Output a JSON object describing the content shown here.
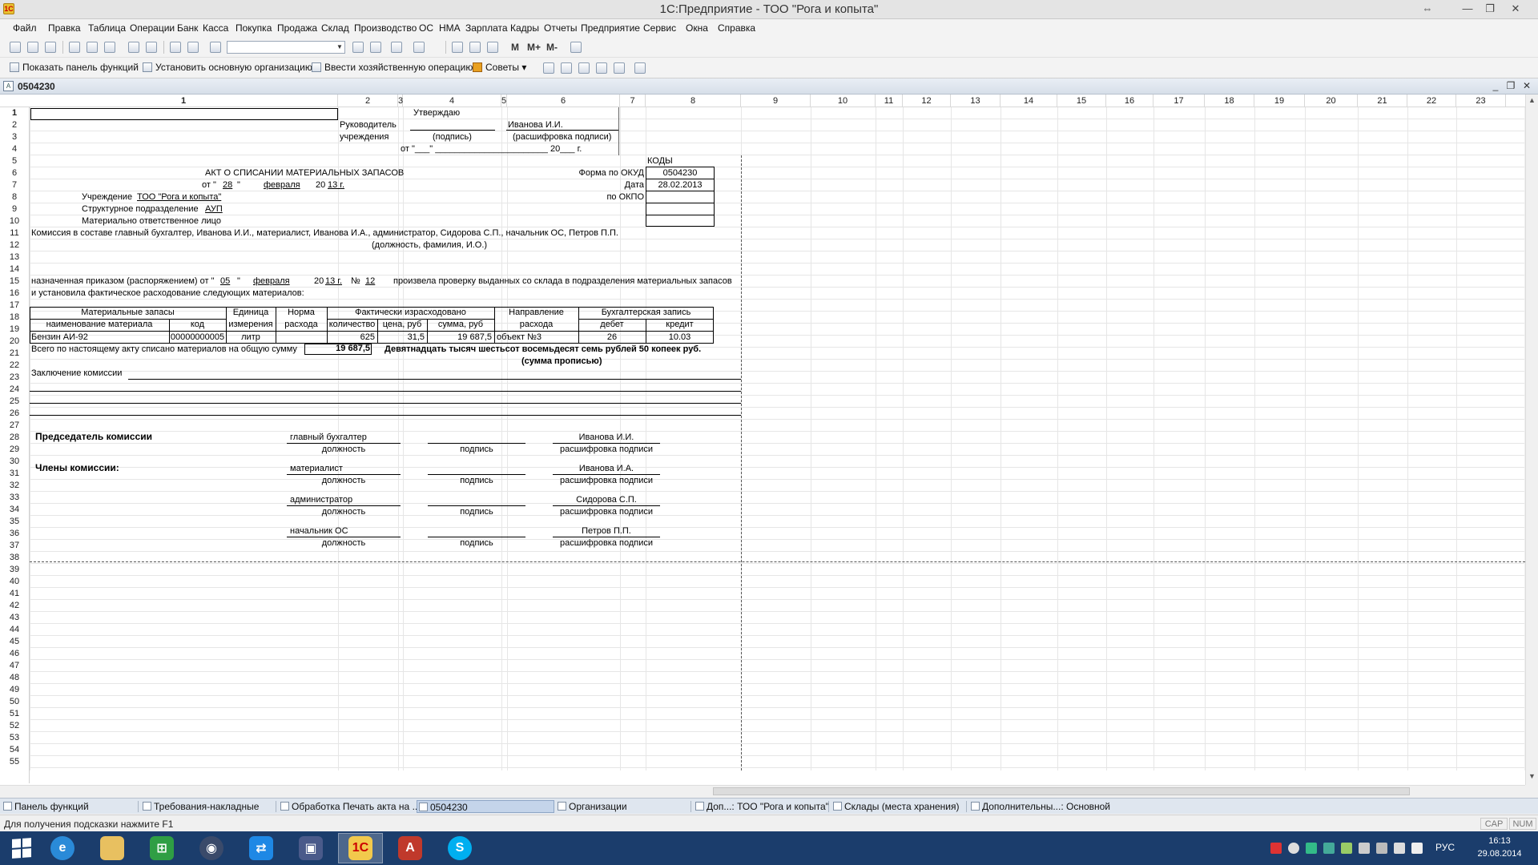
{
  "window": {
    "title": "1С:Предприятие - ТОО \"Рога и копыта\""
  },
  "menu": [
    "Файл",
    "Правка",
    "Таблица",
    "Операции",
    "Банк",
    "Касса",
    "Покупка",
    "Продажа",
    "Склад",
    "Производство",
    "ОС",
    "НМА",
    "Зарплата",
    "Кадры",
    "Отчеты",
    "Предприятие",
    "Сервис",
    "Окна",
    "Справка"
  ],
  "toolbar1": {
    "m_label": "M",
    "mplus_label": "M+",
    "mminus_label": "M-"
  },
  "toolbar2": {
    "show_panel": "Показать панель функций",
    "set_org": "Установить основную организацию",
    "enter_op": "Ввести хозяйственную операцию",
    "tips": "Советы"
  },
  "document": {
    "title": "0504230"
  },
  "sheet": {
    "columns": [
      "1",
      "2",
      "3",
      "4",
      "5",
      "6",
      "7",
      "8",
      "9",
      "10",
      "11",
      "12",
      "13",
      "14",
      "15",
      "16",
      "17",
      "18",
      "19",
      "20",
      "21",
      "22",
      "23"
    ],
    "rows": [
      "1",
      "2",
      "3",
      "4",
      "5",
      "6",
      "7",
      "8",
      "9",
      "10",
      "11",
      "12",
      "13",
      "14",
      "15",
      "16",
      "17",
      "18",
      "19",
      "20",
      "21",
      "22",
      "23",
      "24",
      "25",
      "26",
      "27",
      "28",
      "29",
      "30",
      "31",
      "32",
      "33",
      "34",
      "35",
      "36",
      "37",
      "38",
      "39",
      "40",
      "41",
      "42",
      "43",
      "44",
      "45",
      "46",
      "47",
      "48",
      "49",
      "50",
      "51",
      "52",
      "53",
      "54",
      "55"
    ]
  },
  "form": {
    "approve": "Утверждаю",
    "head_label_1": "Руководитель",
    "head_label_2": "учреждения",
    "head_name": "Иванова И.И.",
    "signature_caption": "(подпись)",
    "decoding_caption": "(расшифровка подписи)",
    "date_line": "от \"___\" _______________________ 20___ г.",
    "codes": "КОДЫ",
    "act_title": "АКТ О СПИСАНИИ МАТЕРИАЛЬНЫХ ЗАПАСОВ",
    "okud_label": "Форма по ОКУД",
    "okud_value": "0504230",
    "date_label": "Дата",
    "date_value": "28.02.2013",
    "okpo_label": "по ОКПО",
    "act_date_from": "от \"",
    "act_day": "28",
    "act_quote": "\"",
    "act_month": "февраля",
    "act_year_prefix": "20",
    "act_year": "13 г.",
    "institution_label": "Учреждение",
    "institution_value": "ТОО \"Рога и копыта\"",
    "division_label": "Структурное подразделение",
    "division_value": "АУП",
    "responsible_label": "Материально ответственное лицо",
    "commission_line": "Комиссия в составе  главный бухгалтер, Иванова И.И., материалист, Иванова И.А., администратор, Сидорова С.П., начальник ОС, Петров П.П.",
    "commission_caption": "(должность, фамилия, И.О.)",
    "order_prefix": "назначенная приказом (распоряжением) от \"",
    "order_day": "05",
    "order_quote": "\"",
    "order_month": "февраля",
    "order_year_prefix": "20",
    "order_year": "13 г.",
    "order_no_label": "№",
    "order_no": "12",
    "order_text": "произвела проверку выданных со склада в подразделения материальных запасов",
    "order_text2": "и установила фактическое расходование следующих материалов:",
    "total_label": "Всего по настоящему акту списано материалов на общую сумму",
    "total_value": "19 687,5",
    "total_words": "Девятнадцать тысяч шестьсот восемьдесят семь рублей 50 копеек руб.",
    "total_words_caption": "(сумма прописью)",
    "conclusion_label": "Заключение комиссии",
    "chairman_label": "Председатель комиссии",
    "members_label": "Члены комиссии:",
    "position_caption": "должность",
    "sign_caption": "подпись",
    "decode_caption": "расшифровка подписи"
  },
  "table": {
    "h_materials": "Материальные запасы",
    "h_name": "наименование материала",
    "h_code": "код",
    "h_unit1": "Единица",
    "h_unit2": "измерения",
    "h_norm1": "Норма",
    "h_norm2": "расхода",
    "h_actual": "Фактически израсходовано",
    "h_qty": "количество",
    "h_price": "цена, руб",
    "h_sum": "сумма, руб",
    "h_dir1": "Направление",
    "h_dir2": "расхода",
    "h_acc": "Бухгалтерская запись",
    "h_debit": "дебет",
    "h_credit": "кредит",
    "row": {
      "name": "Бензин АИ-92",
      "code": "00000000005",
      "unit": "литр",
      "norm": "",
      "qty": "625",
      "price": "31,5",
      "sum": "19 687,5",
      "direction": "объект №3",
      "debit": "26",
      "credit": "10.03"
    }
  },
  "signers": [
    {
      "position": "главный бухгалтер",
      "name": "Иванова И.И."
    },
    {
      "position": "материалист",
      "name": "Иванова И.А."
    },
    {
      "position": "администратор",
      "name": "Сидорова С.П."
    },
    {
      "position": "начальник ОС",
      "name": "Петров П.П."
    }
  ],
  "window_tabs": [
    "Панель функций",
    "Требования-накладные",
    "Обработка  Печать акта на ...",
    "0504230",
    "Организации",
    "Доп...: ТОО \"Рога и копыта\"",
    "Склады (места хранения)",
    "Дополнительны...: Основной"
  ],
  "status": {
    "hint": "Для получения подсказки нажмите F1",
    "cap": "CAP",
    "num": "NUM"
  },
  "taskbar": {
    "lang": "РУС",
    "time": "16:13",
    "date": "29.08.2014"
  },
  "colors": {
    "taskbar": "#1b3d6c",
    "tab_active": "#c4d4ea"
  }
}
